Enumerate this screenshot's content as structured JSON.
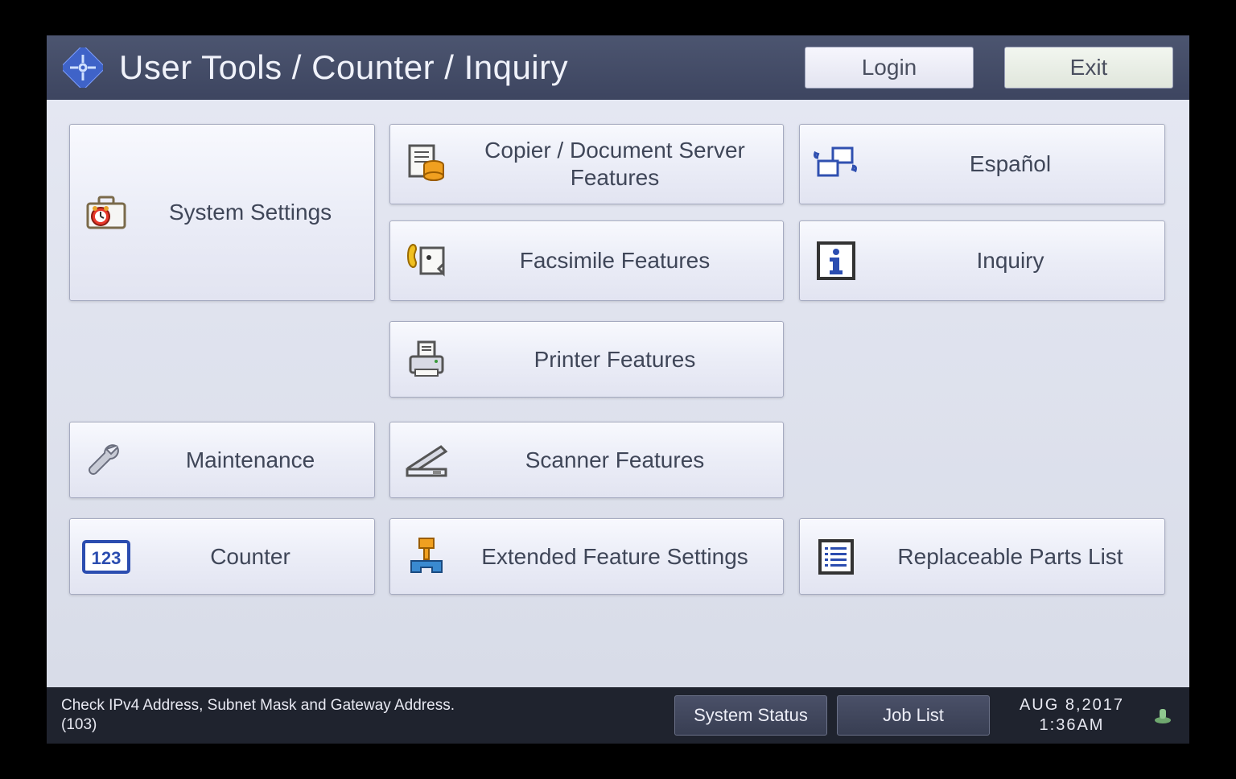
{
  "header": {
    "title": "User Tools / Counter / Inquiry",
    "login_label": "Login",
    "exit_label": "Exit"
  },
  "tiles": {
    "system_settings": "System Settings",
    "maintenance": "Maintenance",
    "counter": "Counter",
    "copier_doc_server": "Copier / Document Server Features",
    "facsimile": "Facsimile Features",
    "printer": "Printer Features",
    "scanner": "Scanner Features",
    "extended": "Extended Feature Settings",
    "language": "Español",
    "inquiry": "Inquiry",
    "parts_list": "Replaceable Parts List"
  },
  "footer": {
    "status_message": "Check IPv4 Address, Subnet Mask and Gateway Address.",
    "status_code": "(103)",
    "system_status_label": "System Status",
    "job_list_label": "Job List",
    "date": "AUG   8,2017",
    "time": "1:36AM"
  }
}
